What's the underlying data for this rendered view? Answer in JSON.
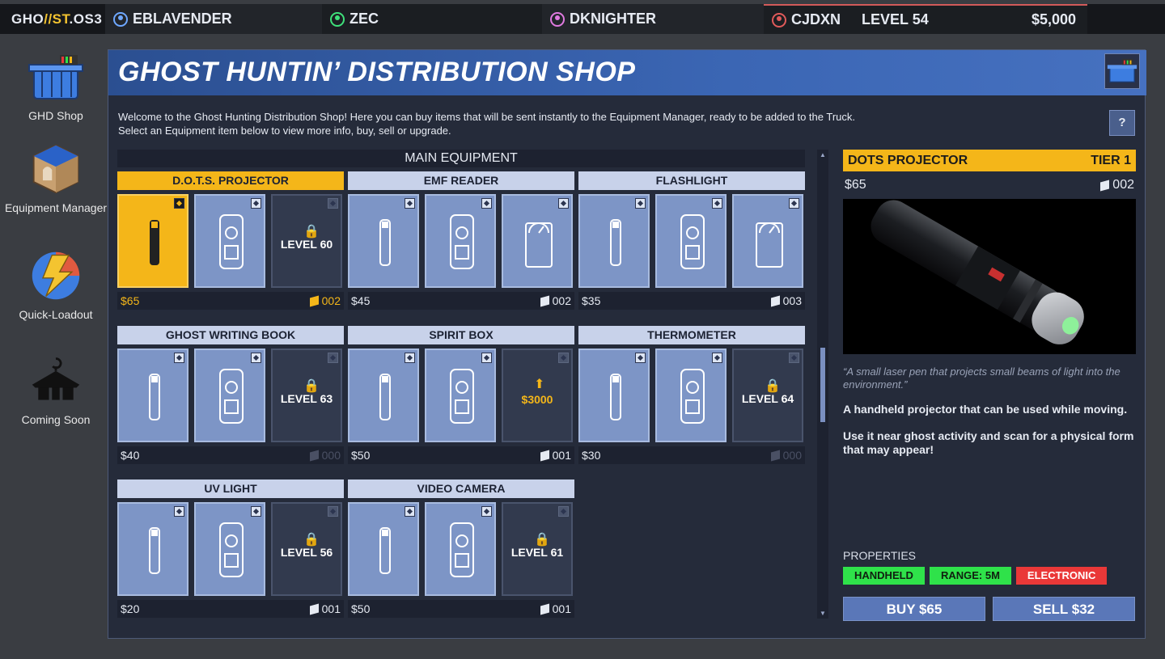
{
  "topbar": {
    "brand_prefix": "GHO",
    "brand_mid": "//ST",
    "brand_suffix": ".OS3",
    "players": [
      {
        "name": "EBLAVENDER",
        "color": "#6fa8ff"
      },
      {
        "name": "ZEC",
        "color": "#3fe07a"
      },
      {
        "name": "DKNIGHTER",
        "color": "#e07ae0"
      },
      {
        "name": "CJDXN",
        "color": "#e05a5a"
      }
    ],
    "level": "LEVEL 54",
    "money": "$5,000"
  },
  "sidebar": {
    "items": [
      {
        "label": "GHD Shop",
        "icon": "basket-icon"
      },
      {
        "label": "Equipment Manager",
        "icon": "box-icon"
      },
      {
        "label": "Quick-Loadout",
        "icon": "lightning-icon"
      },
      {
        "label": "Coming Soon",
        "icon": "hanger-icon"
      }
    ]
  },
  "shop": {
    "title": "GHOST HUNTIN’ DISTRIBUTION SHOP",
    "welcome_line1": "Welcome to the Ghost Hunting Distribution Shop! Here you can buy items that will be sent instantly to the Equipment Manager, ready to be added to the Truck.",
    "welcome_line2": "Select an Equipment item below to view more info, buy, sell or upgrade.",
    "help": "?",
    "section": "MAIN EQUIPMENT",
    "groups": [
      {
        "name": "D.O.T.S. PROJECTOR",
        "price": "$65",
        "count": "002",
        "tiles": [
          {
            "state": "selected"
          },
          {
            "state": "normal"
          },
          {
            "state": "locked",
            "label": "LEVEL 60"
          }
        ]
      },
      {
        "name": "EMF READER",
        "price": "$45",
        "count": "002",
        "tiles": [
          {
            "state": "normal"
          },
          {
            "state": "normal"
          },
          {
            "state": "normal"
          }
        ]
      },
      {
        "name": "FLASHLIGHT",
        "price": "$35",
        "count": "003",
        "tiles": [
          {
            "state": "normal"
          },
          {
            "state": "normal"
          },
          {
            "state": "normal"
          }
        ]
      },
      {
        "name": "GHOST WRITING BOOK",
        "price": "$40",
        "count": "000",
        "tiles": [
          {
            "state": "normal"
          },
          {
            "state": "normal"
          },
          {
            "state": "locked",
            "label": "LEVEL 63"
          }
        ]
      },
      {
        "name": "SPIRIT BOX",
        "price": "$50",
        "count": "001",
        "tiles": [
          {
            "state": "normal"
          },
          {
            "state": "normal"
          },
          {
            "state": "upgrade",
            "label": "$3000"
          }
        ]
      },
      {
        "name": "THERMOMETER",
        "price": "$30",
        "count": "000",
        "tiles": [
          {
            "state": "normal"
          },
          {
            "state": "normal"
          },
          {
            "state": "locked",
            "label": "LEVEL 64"
          }
        ]
      },
      {
        "name": "UV LIGHT",
        "price": "$20",
        "count": "001",
        "tiles": [
          {
            "state": "normal"
          },
          {
            "state": "normal"
          },
          {
            "state": "locked",
            "label": "LEVEL 56"
          }
        ]
      },
      {
        "name": "VIDEO CAMERA",
        "price": "$50",
        "count": "001",
        "tiles": [
          {
            "state": "normal"
          },
          {
            "state": "normal"
          },
          {
            "state": "locked",
            "label": "LEVEL 61"
          }
        ]
      }
    ]
  },
  "detail": {
    "name": "DOTS PROJECTOR",
    "tier": "TIER 1",
    "price": "$65",
    "count": "002",
    "quote": "“A small laser pen that projects small beams of light into the environment.”",
    "desc1": "A handheld projector that can be used while moving.",
    "desc2": "Use it near ghost activity and scan for a physical form that may appear!",
    "properties_label": "PROPERTIES",
    "properties": [
      {
        "label": "HANDHELD",
        "color": "green"
      },
      {
        "label": "RANGE: 5M",
        "color": "green"
      },
      {
        "label": "ELECTRONIC",
        "color": "red"
      }
    ],
    "buy": "BUY $65",
    "sell": "SELL $32"
  }
}
